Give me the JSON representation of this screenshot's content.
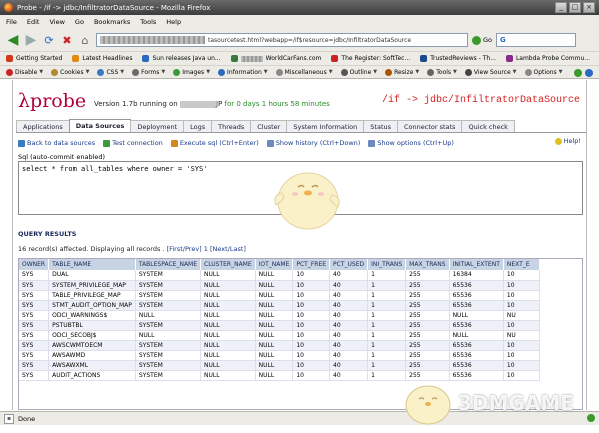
{
  "window": {
    "title": "Probe - /if -> jdbc/InfiltratorDataSource - Mozilla Firefox",
    "buttons": [
      "_",
      "□",
      "×"
    ]
  },
  "menu": [
    "File",
    "Edit",
    "View",
    "Go",
    "Bookmarks",
    "Tools",
    "Help"
  ],
  "nav": {
    "url_suffix": "tasourcetest.html?webapp=/if$resource=jdbc/InfiltratorDataSource",
    "go_label": "Go",
    "search_value": "G"
  },
  "bookmarks": [
    {
      "label": "Getting Started",
      "color": "#d43a1a"
    },
    {
      "label": "Latest Headlines",
      "color": "#e08a10"
    },
    {
      "label": "Sun releases Java un...",
      "color": "#2a6ac0"
    },
    {
      "label": "WorldCarFans.com",
      "color": "#3a7a3a"
    },
    {
      "label": "The Register: SoftTec...",
      "color": "#c22"
    },
    {
      "label": "TrustedReviews - Th...",
      "color": "#1a4a8a"
    },
    {
      "label": "Lambda Probe Commu...",
      "color": "#8a2a8a"
    }
  ],
  "devbar": [
    {
      "label": "Disable",
      "color": "#c22"
    },
    {
      "label": "Cookies",
      "color": "#b08a30"
    },
    {
      "label": "CSS",
      "color": "#3a7ac0"
    },
    {
      "label": "Forms",
      "color": "#6a6a6a"
    },
    {
      "label": "Images",
      "color": "#3a9a3a"
    },
    {
      "label": "Information",
      "color": "#2a6ac0"
    },
    {
      "label": "Miscellaneous",
      "color": "#888"
    },
    {
      "label": "Outline",
      "color": "#555"
    },
    {
      "label": "Resize",
      "color": "#aa5500"
    },
    {
      "label": "Tools",
      "color": "#666"
    },
    {
      "label": "View Source",
      "color": "#444"
    },
    {
      "label": "Options",
      "color": "#888"
    }
  ],
  "app": {
    "logo": "λprobe",
    "version_prefix": "Version 1.7b running on",
    "version_middle": "JP",
    "uptime": "for 0 days 1 hours 58 minutes",
    "breadcrumb": "/if -> jdbc/InfiltratorDataSource"
  },
  "tabs": [
    {
      "label": "Applications",
      "active": false
    },
    {
      "label": "Data Sources",
      "active": true
    },
    {
      "label": "Deployment",
      "active": false
    },
    {
      "label": "Logs",
      "active": false
    },
    {
      "label": "Threads",
      "active": false
    },
    {
      "label": "Cluster",
      "active": false
    },
    {
      "label": "System Information",
      "active": false
    },
    {
      "label": "Status",
      "active": false
    },
    {
      "label": "Connector stats",
      "active": false
    },
    {
      "label": "Quick check",
      "active": false
    }
  ],
  "toolbar": {
    "back": "Back to data sources",
    "test": "Test connection",
    "execute": "Execute sql (Ctrl+Enter)",
    "history": "Show history (Ctrl+Down)",
    "options": "Show options (Ctrl+Up)",
    "help": "Help!"
  },
  "sql": {
    "label": "Sql (auto-commit enabled)",
    "query": "select * from all_tables where owner = 'SYS'"
  },
  "results": {
    "heading": "QUERY RESULTS",
    "summary": "16 record(s) affected. Displaying all records .",
    "pager": "[First/Prev] 1 [Next/Last]",
    "columns": [
      "OWNER",
      "TABLE_NAME",
      "TABLESPACE_NAME",
      "CLUSTER_NAME",
      "IOT_NAME",
      "PCT_FREE",
      "PCT_USED",
      "INI_TRANS",
      "MAX_TRANS",
      "INITIAL_EXTENT",
      "NEXT_E"
    ],
    "rows": [
      [
        "SYS",
        "DUAL",
        "SYSTEM",
        "NULL",
        "NULL",
        "10",
        "40",
        "1",
        "255",
        "16384",
        "10"
      ],
      [
        "SYS",
        "SYSTEM_PRIVILEGE_MAP",
        "SYSTEM",
        "NULL",
        "NULL",
        "10",
        "40",
        "1",
        "255",
        "65536",
        "10"
      ],
      [
        "SYS",
        "TABLE_PRIVILEGE_MAP",
        "SYSTEM",
        "NULL",
        "NULL",
        "10",
        "40",
        "1",
        "255",
        "65536",
        "10"
      ],
      [
        "SYS",
        "STMT_AUDIT_OPTION_MAP",
        "SYSTEM",
        "NULL",
        "NULL",
        "10",
        "40",
        "1",
        "255",
        "65536",
        "10"
      ],
      [
        "SYS",
        "ODCI_WARNINGS$",
        "NULL",
        "NULL",
        "NULL",
        "10",
        "40",
        "1",
        "255",
        "NULL",
        "NU"
      ],
      [
        "SYS",
        "PSTUBTBL",
        "SYSTEM",
        "NULL",
        "NULL",
        "10",
        "40",
        "1",
        "255",
        "65536",
        "10"
      ],
      [
        "SYS",
        "ODCI_SECOBJ$",
        "NULL",
        "NULL",
        "NULL",
        "10",
        "40",
        "1",
        "255",
        "NULL",
        "NU"
      ],
      [
        "SYS",
        "AWSCWMTOECM",
        "SYSTEM",
        "NULL",
        "NULL",
        "10",
        "40",
        "1",
        "255",
        "65536",
        "10"
      ],
      [
        "SYS",
        "AWSAWMD",
        "SYSTEM",
        "NULL",
        "NULL",
        "10",
        "40",
        "1",
        "255",
        "65536",
        "10"
      ],
      [
        "SYS",
        "AWSAWXML",
        "SYSTEM",
        "NULL",
        "NULL",
        "10",
        "40",
        "1",
        "255",
        "65536",
        "10"
      ],
      [
        "SYS",
        "AUDIT_ACTIONS",
        "SYSTEM",
        "NULL",
        "NULL",
        "10",
        "40",
        "1",
        "255",
        "65536",
        "10"
      ]
    ]
  },
  "status": {
    "text": "Done"
  },
  "watermark": {
    "text": "3DMGAME"
  }
}
